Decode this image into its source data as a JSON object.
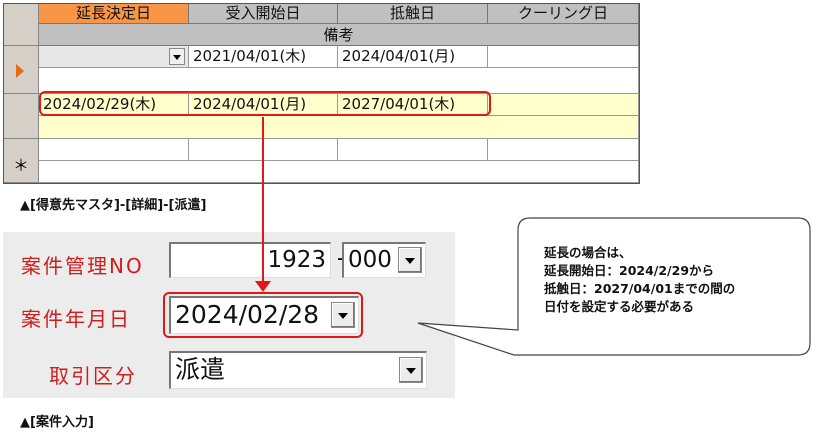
{
  "grid": {
    "headers": [
      "延長決定日",
      "受入開始日",
      "抵触日",
      "クーリング日"
    ],
    "subheader": "備考",
    "current_row": {
      "dropdown_value": "",
      "start": "2021/04/01(木)",
      "conflict": "2024/04/01(月)",
      "cooling": ""
    },
    "extended_row": {
      "extension": "2024/02/29(木)",
      "start": "2024/04/01(月)",
      "conflict": "2027/04/01(木)",
      "cooling": ""
    },
    "new_row_marker": "＊",
    "caption": "▲[得意先マスタ]-[詳細]-[派遣]"
  },
  "form": {
    "case_no_label": "案件管理NO",
    "case_no_value": "1923",
    "case_no_sep": "-",
    "case_no_sub": "000",
    "case_date_label": "案件年月日",
    "case_date_value": "2024/02/28",
    "category_label": "取引区分",
    "category_value": "派遣",
    "caption": "▲[案件入力]"
  },
  "callout": {
    "lines": [
      "延長の場合は、",
      "延長開始日：2024/2/29から",
      "抵触日：2027/04/01までの間の",
      "日付を設定する必要がある"
    ]
  },
  "colors": {
    "highlight": "#e01818",
    "selected_header": "#f79646",
    "row_highlight": "#ffffcc",
    "label_red": "#d11c1c"
  }
}
